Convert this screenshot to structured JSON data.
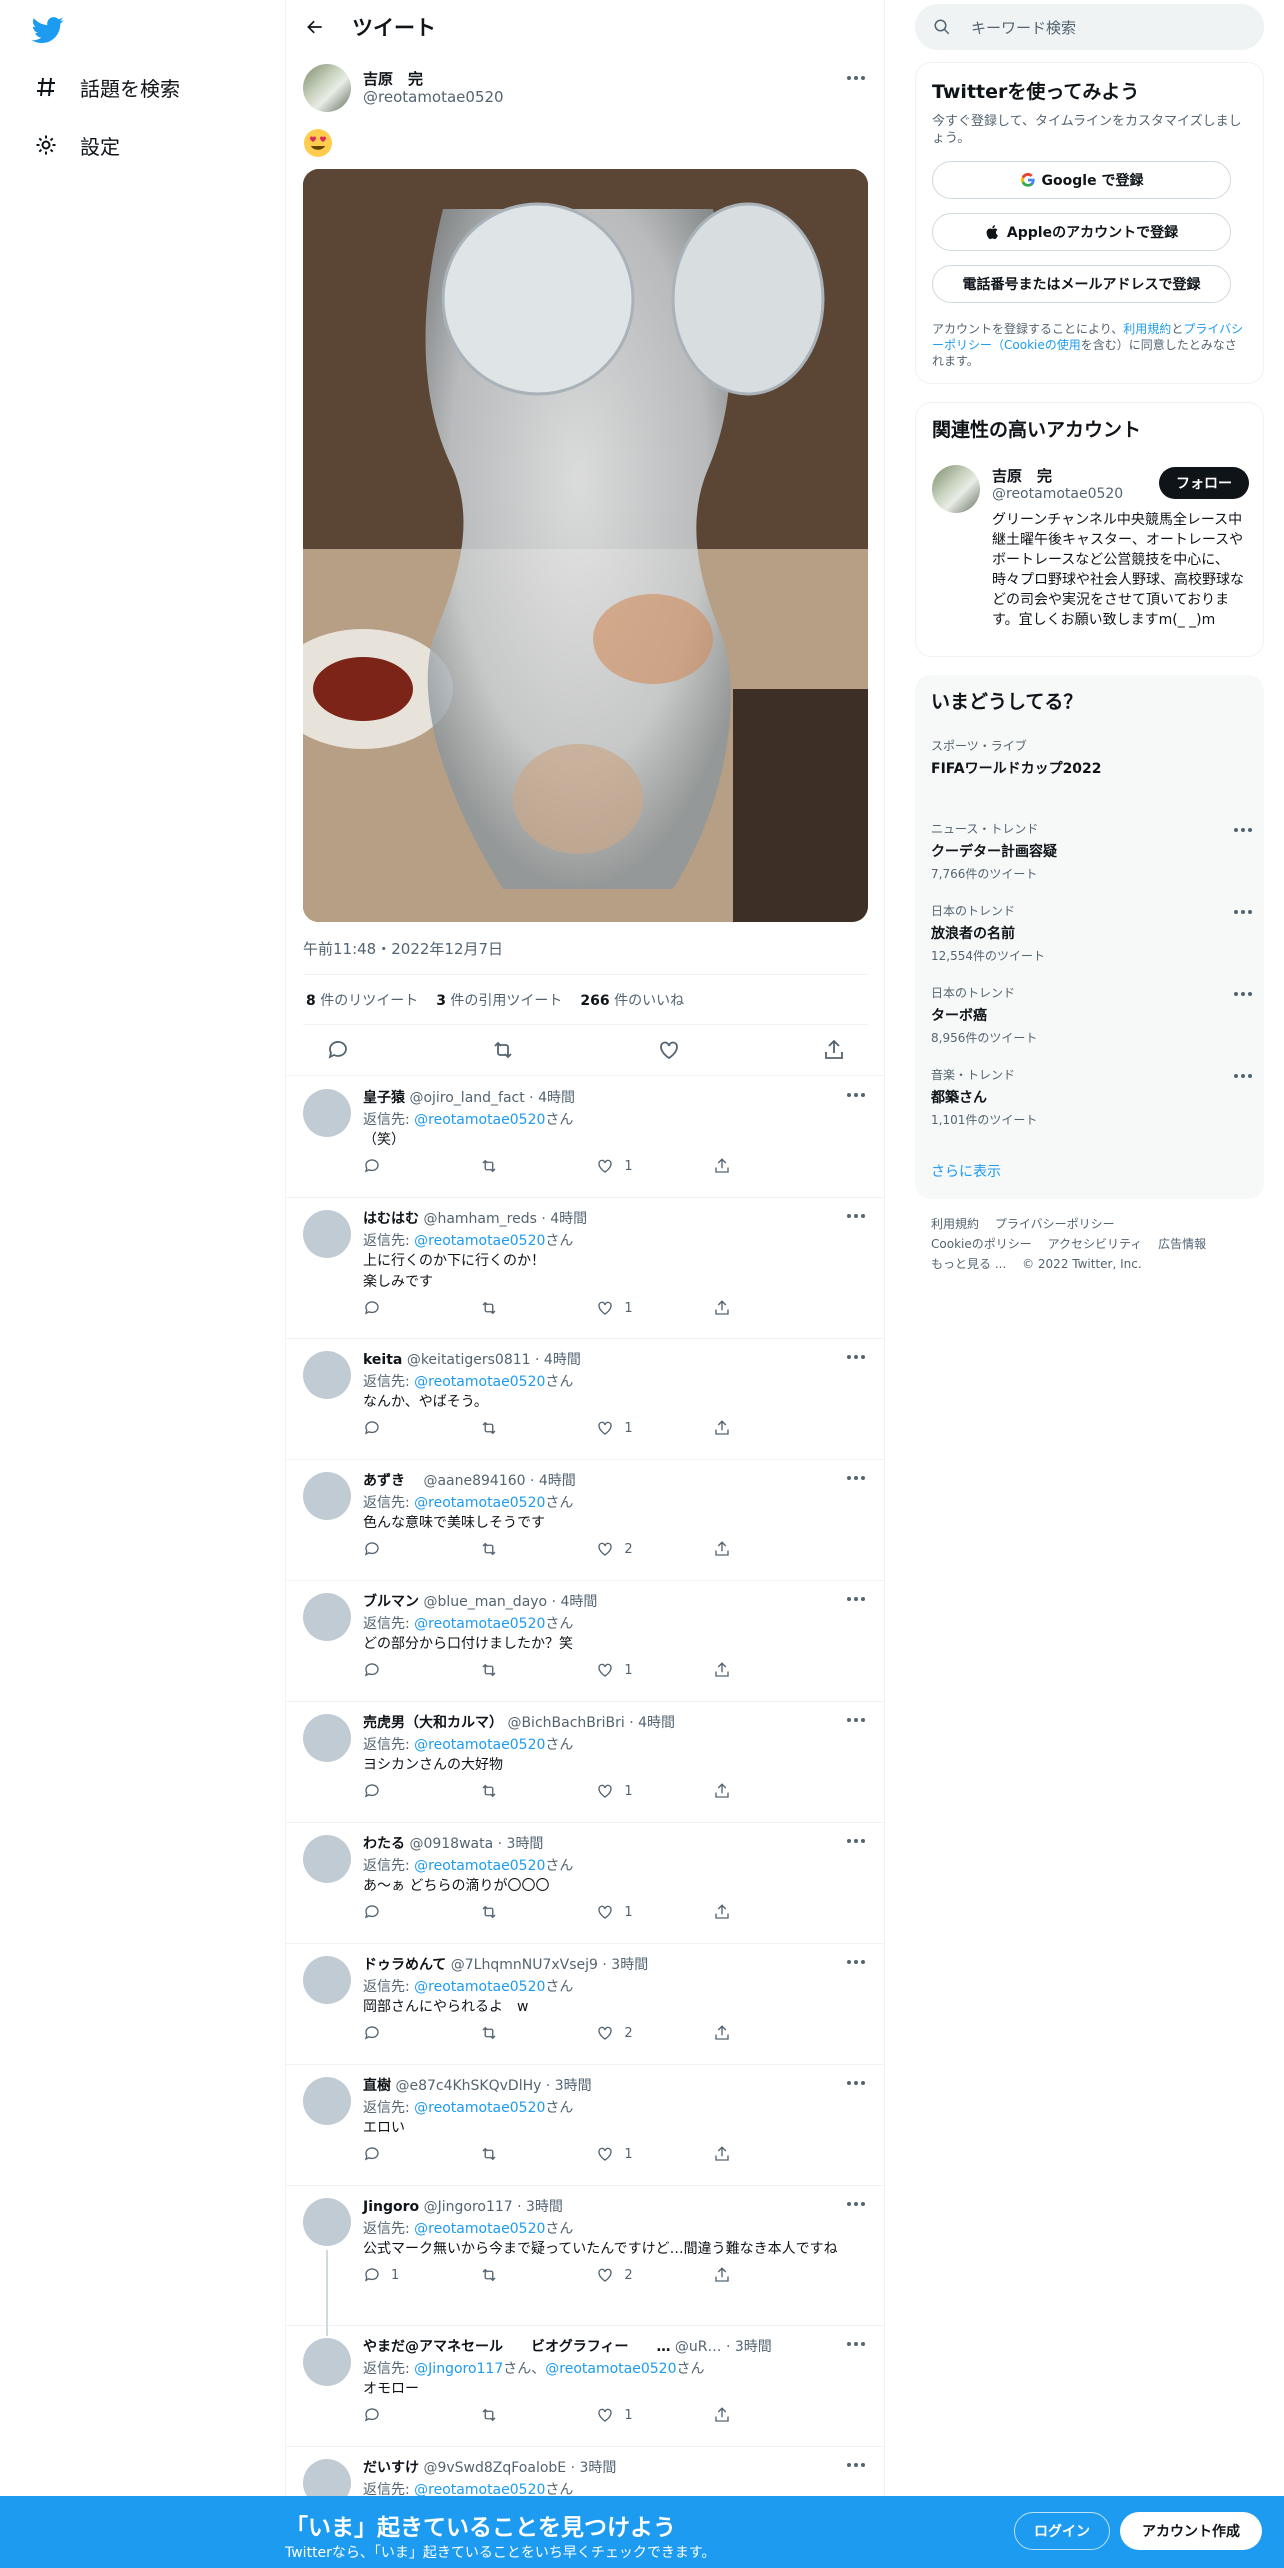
{
  "nav": {
    "explore_label": "話題を検索",
    "settings_label": "設定"
  },
  "header": {
    "title": "ツイート"
  },
  "tweet": {
    "name": "吉原　完",
    "handle": "@reotamotae0520",
    "emoji": "😍",
    "timestamp": "午前11:48・2022年12月7日",
    "retweets": "8",
    "retweets_label": "件のリツイート",
    "quotes": "3",
    "quotes_label": "件の引用ツイート",
    "likes": "266",
    "likes_label": "件のいいね"
  },
  "replies": [
    {
      "name": "皇子猿",
      "handle": "@ojiro_land_fact · 4時間",
      "replying_prefix": "返信先: ",
      "replying_to": "@reotamotae0520",
      "replying_suffix": "さん",
      "text": "（笑）",
      "likes": "1"
    },
    {
      "name": "はむはむ",
      "handle": "@hamham_reds · 4時間",
      "replying_prefix": "返信先: ",
      "replying_to": "@reotamotae0520",
      "replying_suffix": "さん",
      "text": "上に行くのか下に行くのか！\n楽しみです",
      "likes": "1"
    },
    {
      "name": "keita",
      "handle": "@keitatigers0811 · 4時間",
      "replying_prefix": "返信先: ",
      "replying_to": "@reotamotae0520",
      "replying_suffix": "さん",
      "text": "なんか、やばそう。",
      "likes": "1"
    },
    {
      "name": "あずき　",
      "handle": "@aane894160 · 4時間",
      "replying_prefix": "返信先: ",
      "replying_to": "@reotamotae0520",
      "replying_suffix": "さん",
      "text": "色んな意味で美味しそうです",
      "likes": "2"
    },
    {
      "name": "ブルマン",
      "handle": "@blue_man_dayo · 4時間",
      "replying_prefix": "返信先: ",
      "replying_to": "@reotamotae0520",
      "replying_suffix": "さん",
      "text": "どの部分から口付けましたか？笑",
      "likes": "1"
    },
    {
      "name": "売虎男（大和カルマ）",
      "handle": "@BichBachBriBri · 4時間",
      "replying_prefix": "返信先: ",
      "replying_to": "@reotamotae0520",
      "replying_suffix": "さん",
      "text": "ヨシカンさんの大好物",
      "likes": "1"
    },
    {
      "name": "わたる",
      "handle": "@0918wata · 3時間",
      "replying_prefix": "返信先: ",
      "replying_to": "@reotamotae0520",
      "replying_suffix": "さん",
      "text": "あ〜ぁ どちらの滴りが〇〇〇",
      "likes": "1"
    },
    {
      "name": "ドゥラめんて",
      "handle": "@7LhqmnNU7xVsej9 · 3時間",
      "replying_prefix": "返信先: ",
      "replying_to": "@reotamotae0520",
      "replying_suffix": "さん",
      "text": "岡部さんにやられるよ　w",
      "likes": "2"
    },
    {
      "name": "直樹",
      "handle": "@e87c4KhSKQvDlHy · 3時間",
      "replying_prefix": "返信先: ",
      "replying_to": "@reotamotae0520",
      "replying_suffix": "さん",
      "text": "エロい",
      "likes": "1"
    },
    {
      "name": "Jingoro",
      "handle": "@Jingoro117 · 3時間",
      "replying_prefix": "返信先: ",
      "replying_to": "@reotamotae0520",
      "replying_suffix": "さん",
      "text": "公式マーク無いから今まで疑っていたんですけど…間違う難なき本人ですね",
      "replies": "1",
      "likes": "2"
    },
    {
      "name": "やまだ@アマネセール　　ビオグラフィー　　…",
      "handle": "@uR… · 3時間",
      "replying_prefix": "返信先: ",
      "replying_to": "@Jingoro117",
      "replying_suffix": "さん、",
      "replying_to2": "@reotamotae0520",
      "replying_suffix2": "さん",
      "text": "オモロー",
      "likes": "1"
    },
    {
      "name": "だいすけ",
      "handle": "@9vSwd8ZqFoalobE · 3時間",
      "replying_prefix": "返信先: ",
      "replying_to": "@reotamotae0520",
      "replying_suffix": "さん",
      "text": "",
      "likes": ""
    }
  ],
  "search": {
    "placeholder": "キーワード検索"
  },
  "signup_card": {
    "title": "Twitterを使ってみよう",
    "subtitle": "今すぐ登録して、タイムラインをカスタマイズしましょう。",
    "google_label": "Google で登録",
    "apple_label": "Appleのアカウントで登録",
    "phone_label": "電話番号またはメールアドレスで登録",
    "legal_prefix": "アカウントを登録することにより、",
    "legal_terms": "利用規約",
    "legal_and": "と",
    "legal_privacy": "プライバシーポリシー（Cookieの使用",
    "legal_suffix": "を含む）に同意したとみなされます。"
  },
  "related_card": {
    "title": "関連性の高いアカウント",
    "name": "吉原　完",
    "handle": "@reotamotae0520",
    "follow_label": "フォロー",
    "bio": "グリーンチャンネル中央競馬全レース中継土曜午後キャスター、オートレースやボートレースなど公営競技を中心に、時々プロ野球や社会人野球、高校野球などの司会や実況をさせて頂いております。宜しくお願い致しますm(_ _)m"
  },
  "trends_card": {
    "title": "いまどうしてる？",
    "items": [
      {
        "context": "スポーツ・ライブ",
        "name": "FIFAワールドカップ2022",
        "count": ""
      },
      {
        "context": "ニュース・トレンド",
        "name": "クーデター計画容疑",
        "count": "7,766件のツイート"
      },
      {
        "context": "日本のトレンド",
        "name": "放浪者の名前",
        "count": "12,554件のツイート"
      },
      {
        "context": "日本のトレンド",
        "name": "ターボ癌",
        "count": "8,956件のツイート"
      },
      {
        "context": "音楽・トレンド",
        "name": "都築さん",
        "count": "1,101件のツイート"
      }
    ],
    "show_more": "さらに表示"
  },
  "footer": {
    "terms": "利用規約",
    "privacy": "プライバシーポリシー",
    "cookies": "Cookieのポリシー",
    "accessibility": "アクセシビリティ",
    "ads": "広告情報",
    "more": "もっと見る ...",
    "copyright": "© 2022 Twitter, Inc."
  },
  "bottom_bar": {
    "title": "「いま」起きていることを見つけよう",
    "subtitle": "Twitterなら、「いま」起きていることをいち早くチェックできます。",
    "login_label": "ログイン",
    "signup_label": "アカウント作成"
  },
  "colors": {
    "accent": "#1d9bf0",
    "text": "#0f1419",
    "muted": "#536471",
    "border": "#eff3f4"
  }
}
